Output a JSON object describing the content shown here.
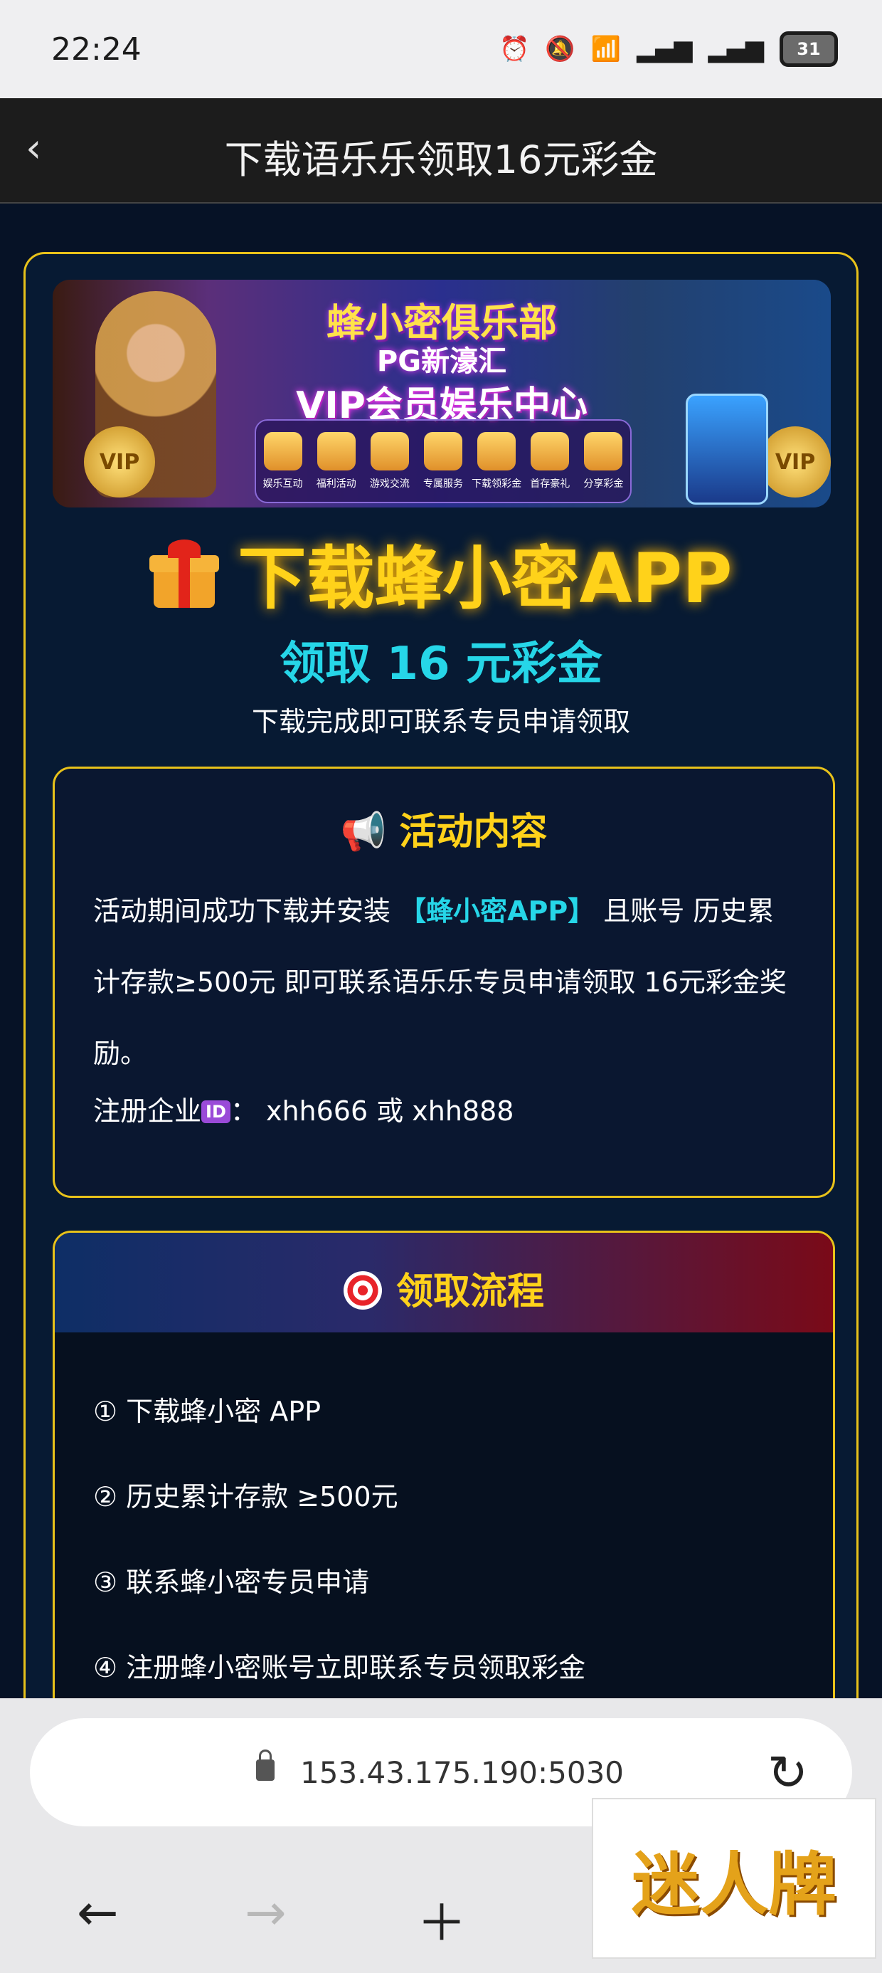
{
  "status_bar": {
    "time": "22:24",
    "icons": [
      "alarm-icon",
      "mute-icon",
      "wifi-icon",
      "signal-5g-icon",
      "signal-5g-icon"
    ],
    "battery": "31"
  },
  "nav": {
    "back_icon": "chevron-left-icon",
    "title": "下载语乐乐领取16元彩金"
  },
  "banner": {
    "line1": "蜂小密俱乐部",
    "line2": "PG新濠汇",
    "line3": "VIP会员娱乐中心",
    "badge": "VIP",
    "menu": [
      "娱乐互动",
      "福利活动",
      "游戏交流",
      "专属服务",
      "下载领彩金",
      "首存豪礼",
      "分享彩金"
    ]
  },
  "hero": {
    "headline": "下载蜂小密APP",
    "subline": "领取 16 元彩金",
    "note": "下载完成即可联系专员申请领取"
  },
  "activity": {
    "heading": "📢 活动内容",
    "text_before": "活动期间成功下载并安装 ",
    "highlight": "【蜂小密APP】",
    "text_after": " 且账号 历史累计存款≥500元 即可联系语乐乐专员申请领取 16元彩金奖励。",
    "register_prefix": "注册企业",
    "register_badge": "ID",
    "register_value": "：  xhh666  或  xhh888"
  },
  "process": {
    "heading": "领取流程",
    "steps": [
      "① 下载蜂小密 APP",
      "② 历史累计存款 ≥500元",
      "③ 联系蜂小密专员申请",
      "④ 注册蜂小密账号立即联系专员领取彩金"
    ]
  },
  "browser": {
    "url": "153.43.175.190:5030",
    "nav_buttons": [
      "back-arrow-icon",
      "forward-arrow-icon",
      "plus-icon",
      "tabs-icon"
    ]
  },
  "watermark": "迷人牌",
  "colors": {
    "accent_gold": "#ffd21a",
    "accent_cyan": "#26d6e8",
    "card_border": "#e8c21a",
    "page_bg": "#06101f"
  }
}
